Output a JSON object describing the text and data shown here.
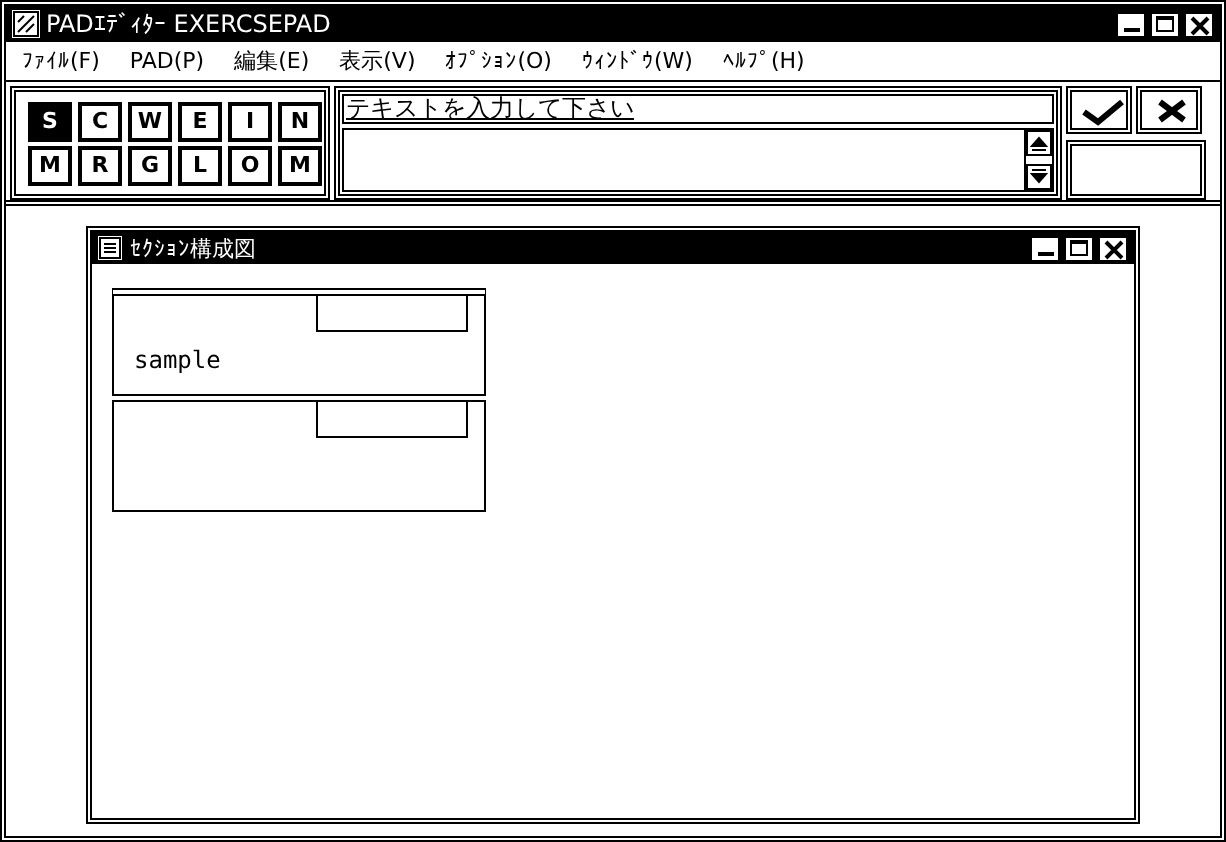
{
  "window": {
    "title": "PADｴﾃﾞｨﾀｰ EXERCSEPAD"
  },
  "menu": [
    {
      "label": "ﾌｧｲﾙ(F)"
    },
    {
      "label": "PAD(P)"
    },
    {
      "label": "編集(E)"
    },
    {
      "label": "表示(V)"
    },
    {
      "label": "ｵﾌﾟｼｮﾝ(O)"
    },
    {
      "label": "ｳｨﾝﾄﾞｳ(W)"
    },
    {
      "label": "ﾍﾙﾌﾟ(H)"
    }
  ],
  "toolbar": [
    {
      "label": "S",
      "selected": true
    },
    {
      "label": "C",
      "selected": false
    },
    {
      "label": "W",
      "selected": false
    },
    {
      "label": "E",
      "selected": false
    },
    {
      "label": "I",
      "selected": false
    },
    {
      "label": "N",
      "selected": false
    },
    {
      "label": "M",
      "selected": false
    },
    {
      "label": "R",
      "selected": false
    },
    {
      "label": "G",
      "selected": false
    },
    {
      "label": "L",
      "selected": false
    },
    {
      "label": "O",
      "selected": false
    },
    {
      "label": "M",
      "selected": false
    }
  ],
  "input": {
    "value": "テキストを入力して下さい"
  },
  "child_window": {
    "title": "ｾｸｼｮﾝ構成図",
    "sections": [
      {
        "kind": "labeled",
        "label": "sample"
      },
      {
        "kind": "blank"
      }
    ]
  }
}
